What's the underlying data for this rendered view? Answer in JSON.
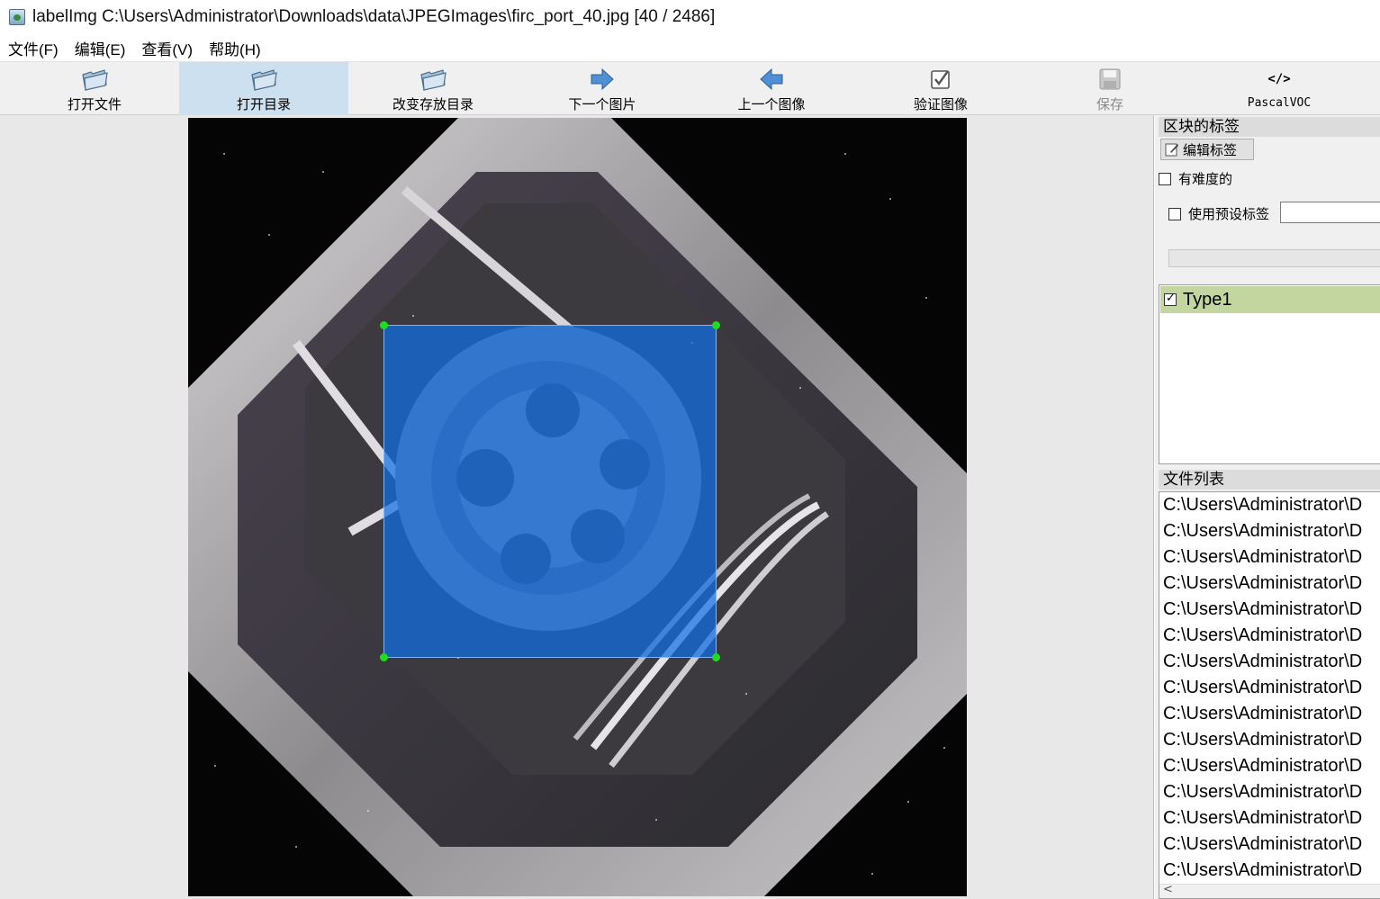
{
  "window": {
    "title": "labelImg C:\\Users\\Administrator\\Downloads\\data\\JPEGImages\\firc_port_40.jpg [40 / 2486]",
    "icon": "labelimg-app-icon"
  },
  "menu": {
    "items": [
      "文件(F)",
      "编辑(E)",
      "查看(V)",
      "帮助(H)"
    ]
  },
  "toolbar": {
    "buttons": [
      {
        "label": "打开文件",
        "icon": "open-folder-icon"
      },
      {
        "label": "打开目录",
        "icon": "open-folder-icon"
      },
      {
        "label": "改变存放目录",
        "icon": "open-folder-icon"
      },
      {
        "label": "下一个图片",
        "icon": "arrow-right-icon"
      },
      {
        "label": "上一个图像",
        "icon": "arrow-left-icon"
      },
      {
        "label": "验证图像",
        "icon": "verify-check-icon"
      },
      {
        "label": "保存",
        "icon": "save-disk-icon"
      },
      {
        "label": "PascalVOC",
        "icon": "code-format-icon",
        "glyph": "</>"
      }
    ]
  },
  "colors": {
    "bbox_fill": "#0f6ee6",
    "handle": "#1fdc1f",
    "label_selected_bg": "#c4d6a0",
    "active_tool_bg": "#cde0ef"
  },
  "dock": {
    "labels_title": "区块的标签",
    "edit_label_button": "编辑标签",
    "difficult_label": "有难度的",
    "use_default_label": "使用预设标签",
    "default_label_value": "",
    "label_items": [
      {
        "name": "Type1",
        "checked": true
      }
    ],
    "file_list_title": "文件列表",
    "files": [
      "C:\\Users\\Administrator\\D",
      "C:\\Users\\Administrator\\D",
      "C:\\Users\\Administrator\\D",
      "C:\\Users\\Administrator\\D",
      "C:\\Users\\Administrator\\D",
      "C:\\Users\\Administrator\\D",
      "C:\\Users\\Administrator\\D",
      "C:\\Users\\Administrator\\D",
      "C:\\Users\\Administrator\\D",
      "C:\\Users\\Administrator\\D",
      "C:\\Users\\Administrator\\D",
      "C:\\Users\\Administrator\\D",
      "C:\\Users\\Administrator\\D",
      "C:\\Users\\Administrator\\D",
      "C:\\Users\\Administrator\\D"
    ]
  }
}
